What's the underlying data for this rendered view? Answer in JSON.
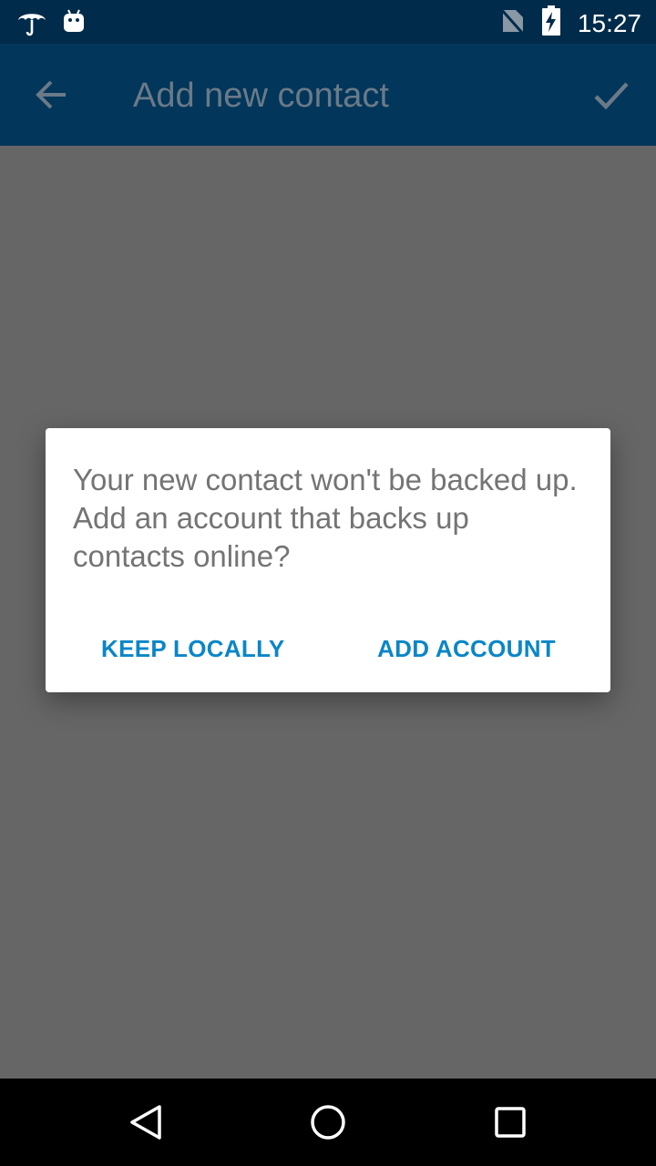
{
  "status_bar": {
    "time": "15:27",
    "left_icons": [
      "umbrella-icon",
      "android-icon"
    ],
    "right_icons": [
      "no-sim-icon",
      "battery-charging-icon"
    ]
  },
  "app_bar": {
    "title": "Add new contact",
    "back_icon": "arrow-back-icon",
    "done_icon": "check-icon"
  },
  "dialog": {
    "message": "Your new contact won't be backed up. Add an account that backs up contacts online?",
    "keep_label": "KEEP LOCALLY",
    "add_label": "ADD ACCOUNT"
  },
  "nav_bar": {
    "icons": [
      "nav-back-icon",
      "nav-home-icon",
      "nav-recents-icon"
    ]
  },
  "colors": {
    "status_bar": "#012b4a",
    "app_bar": "#02365a",
    "scrim": "#666666",
    "dialog_button": "#0a86c8"
  }
}
